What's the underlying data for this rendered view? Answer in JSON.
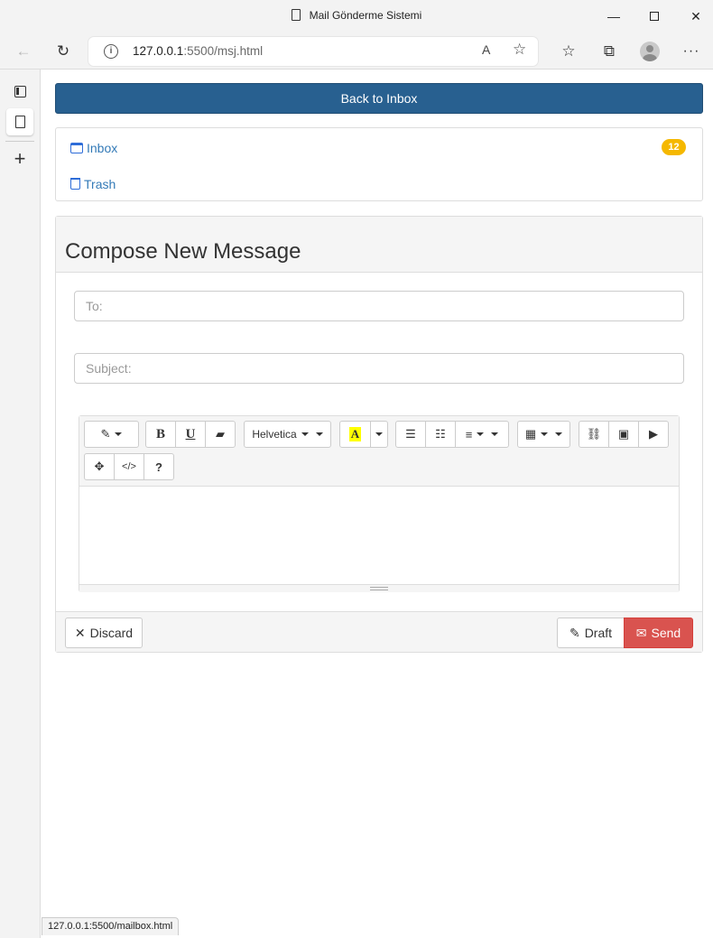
{
  "window": {
    "title": "Mail Gönderme Sistemi"
  },
  "browser": {
    "url_host": "127.0.0.1",
    "url_rest": ":5500/msj.html",
    "read_aloud": "A",
    "status_url": "127.0.0.1:5500/mailbox.html"
  },
  "nav": {
    "back_to_inbox": "Back to Inbox"
  },
  "folders": [
    {
      "label": "Inbox",
      "badge": "12"
    },
    {
      "label": "Trash"
    }
  ],
  "compose": {
    "heading": "Compose New Message",
    "to_placeholder": "To:",
    "subject_placeholder": "Subject:",
    "font_name": "Helvetica",
    "discard_label": "Discard",
    "draft_label": "Draft",
    "send_label": "Send"
  },
  "colors": {
    "primary": "#286090",
    "danger": "#d9534f",
    "badge": "#f5b800",
    "link": "#337ab7"
  }
}
